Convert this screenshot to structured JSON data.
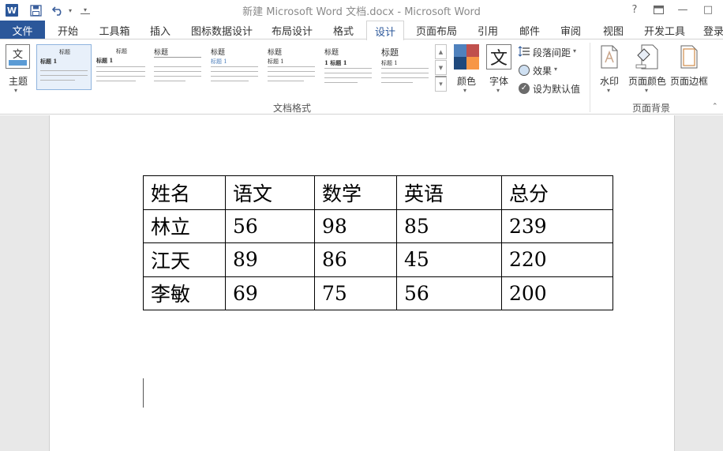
{
  "window": {
    "title": "新建 Microsoft Word 文档.docx - Microsoft Word",
    "app_icon": "W",
    "quick_access": {
      "save": "save-icon",
      "undo": "undo-icon",
      "undo_arrow": "▾",
      "customize": "▾"
    },
    "controls": {
      "help": "?",
      "restore_ribbon": "▭",
      "minimize": "—",
      "maximize": "□"
    }
  },
  "tabs": {
    "file": "文件",
    "home": "开始",
    "toolbox": "工具箱",
    "insert": "插入",
    "chart_design": "图标数据设计",
    "layout_design": "布局设计",
    "format": "格式",
    "design": "设计",
    "page_layout": "页面布局",
    "references": "引用",
    "mailings": "邮件",
    "review": "审阅",
    "view": "视图",
    "developer": "开发工具",
    "login": "登录"
  },
  "ribbon": {
    "theme": {
      "icon_text": "文",
      "icon_sub": "文文",
      "label": "主题"
    },
    "style_thumbs": [
      {
        "title": "标题",
        "heading": "标题 1"
      },
      {
        "title": "标题",
        "heading": "标题 1"
      },
      {
        "title": "标题",
        "heading": ""
      },
      {
        "title": "标题",
        "heading": "标题 1"
      },
      {
        "title": "标题",
        "heading": "标题 1"
      },
      {
        "title": "标题",
        "heading": "1 标题 1"
      },
      {
        "title": "标题",
        "heading": "标题 1"
      }
    ],
    "gallery_controls": {
      "up": "▲",
      "down": "▼",
      "more": "▾"
    },
    "colors": {
      "label": "颜色",
      "swatches": [
        "#4f81bd",
        "#c0504d",
        "#1f497d",
        "#f79646"
      ]
    },
    "fonts": {
      "icon_text": "文",
      "label": "字体"
    },
    "paragraph_spacing": "段落间距",
    "effects": "效果",
    "set_default": "设为默认值",
    "document_format_group": "文档格式",
    "watermark": "水印",
    "page_color": "页面颜色",
    "page_borders": "页面边框",
    "page_background_group": "页面背景"
  },
  "table": {
    "headers": [
      "姓名",
      "语文",
      "数学",
      "英语",
      "总分"
    ],
    "rows": [
      [
        "林立",
        "56",
        "98",
        "85",
        "239"
      ],
      [
        "江天",
        "89",
        "86",
        "45",
        "220"
      ],
      [
        "李敏",
        "69",
        "75",
        "56",
        "200"
      ]
    ]
  }
}
